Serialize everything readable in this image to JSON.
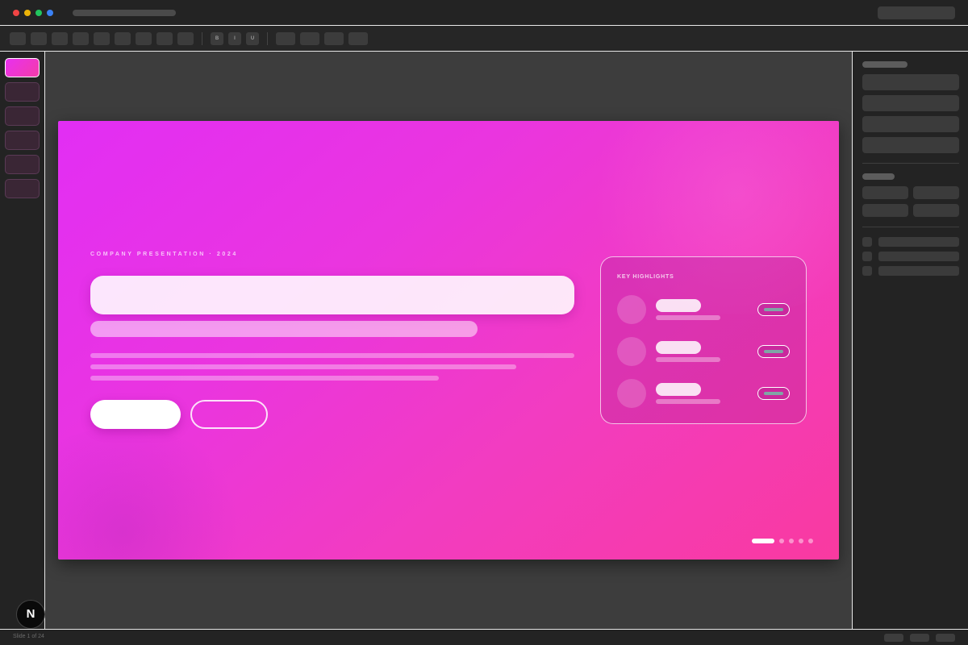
{
  "window": {
    "traffic_colors": [
      "#ef4444",
      "#eab308",
      "#22c55e",
      "#3b82f6"
    ]
  },
  "toolbar": {
    "format_bold": "B",
    "format_italic": "I",
    "format_underline": "U"
  },
  "slide_strip": {
    "count": 6,
    "active_index": 0
  },
  "slide": {
    "eyebrow": "COMPANY PRESENTATION · 2024",
    "highlights": {
      "title": "KEY HIGHLIGHTS",
      "item_count": 3
    },
    "pagination": {
      "dots": 5,
      "active_index": 0
    },
    "colors": {
      "gradient_start": "#e22ef4",
      "gradient_end": "#f93aa0",
      "badge_bar": "#7fa6a6"
    }
  },
  "statusbar": {
    "slide_position": "Slide 1 of 24"
  },
  "logo": {
    "letter": "N"
  }
}
